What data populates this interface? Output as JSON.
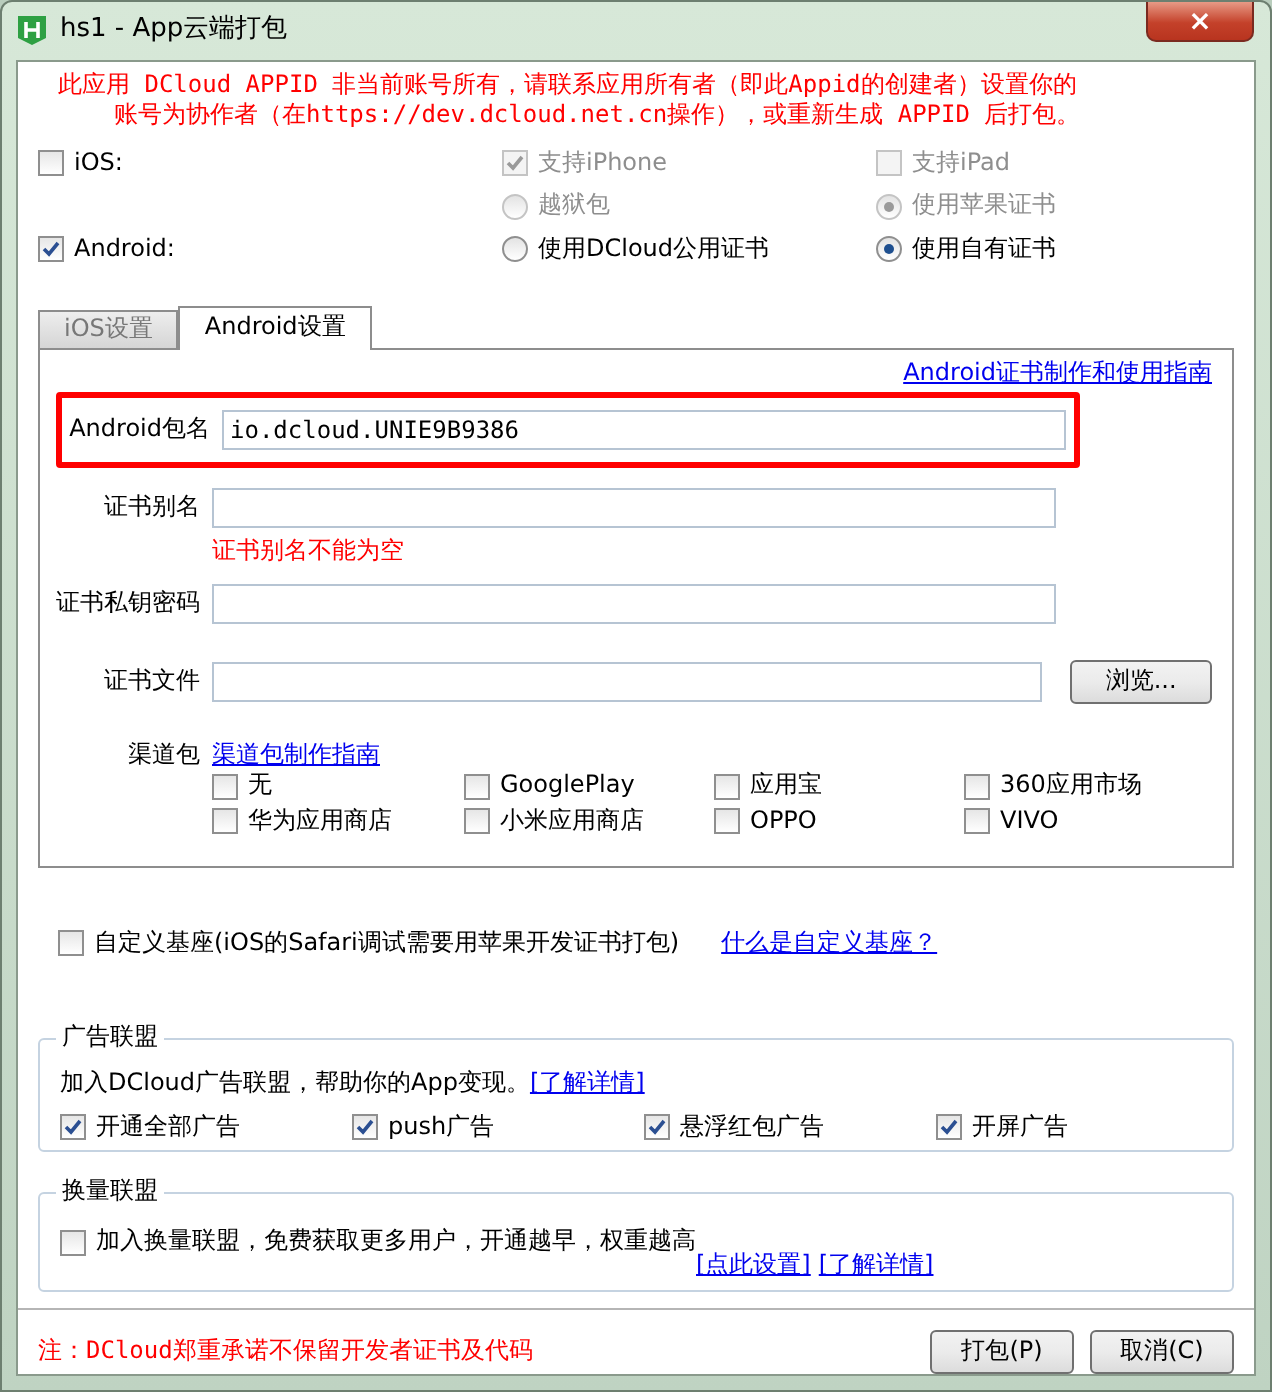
{
  "window": {
    "title": "hs1 - App云端打包",
    "close": "×"
  },
  "notice_lines": [
    "此应用 DCloud APPID 非当前账号所有，请联系应用所有者（即此Appid的创建者）设置你的",
    "账号为协作者（在https://dev.dcloud.net.cn操作），或重新生成 APPID 后打包。"
  ],
  "platform_rows": [
    [
      {
        "kind": "checkbox",
        "label": "iOS:",
        "checked": false,
        "disabled": false
      },
      {
        "kind": "checkbox",
        "label": "支持iPhone",
        "checked": true,
        "disabled": true
      },
      {
        "kind": "checkbox",
        "label": "支持iPad",
        "checked": false,
        "disabled": true
      }
    ],
    [
      {
        "kind": "empty"
      },
      {
        "kind": "radio",
        "label": "越狱包",
        "selected": false,
        "disabled": true
      },
      {
        "kind": "radio",
        "label": "使用苹果证书",
        "selected": true,
        "disabled": true
      }
    ],
    [
      {
        "kind": "checkbox",
        "label": "Android:",
        "checked": true,
        "disabled": false
      },
      {
        "kind": "radio",
        "label": "使用DCloud公用证书",
        "selected": false,
        "disabled": false
      },
      {
        "kind": "radio",
        "label": "使用自有证书",
        "selected": true,
        "disabled": false
      }
    ]
  ],
  "tabs": [
    {
      "label": "iOS设置",
      "selected": false
    },
    {
      "label": "Android设置",
      "selected": true
    }
  ],
  "android": {
    "guide_link": "Android证书制作和使用指南",
    "fields": [
      {
        "label": "Android包名",
        "value": "io.dcloud.UNIE9B9386",
        "highlighted": true
      },
      {
        "label": "证书别名",
        "highlighted": false,
        "error": "证书别名不能为空"
      },
      {
        "label": "证书私钥密码",
        "highlighted": false
      },
      {
        "label": "证书文件",
        "highlighted": false,
        "button": "浏览..."
      }
    ],
    "channels": {
      "label": "渠道包",
      "link": "渠道包制作指南",
      "options": [
        {
          "label": "无",
          "checked": false
        },
        {
          "label": "GooglePlay",
          "checked": false
        },
        {
          "label": "应用宝",
          "checked": false
        },
        {
          "label": "360应用市场",
          "checked": false
        },
        {
          "label": "华为应用商店",
          "checked": false
        },
        {
          "label": "小米应用商店",
          "checked": false
        },
        {
          "label": "OPPO",
          "checked": false
        },
        {
          "label": "VIVO",
          "checked": false
        }
      ]
    }
  },
  "custom_base": {
    "label": "自定义基座(iOS的Safari调试需要用苹果开发证书打包)",
    "checked": false,
    "link": "什么是自定义基座？"
  },
  "ad_union": {
    "legend": "广告联盟",
    "text": "加入DCloud广告联盟，帮助你的App变现。",
    "link": "[了解详情]",
    "options": [
      {
        "label": "开通全部广告",
        "checked": true
      },
      {
        "label": "push广告",
        "checked": true
      },
      {
        "label": "悬浮红包广告",
        "checked": true
      },
      {
        "label": "开屏广告",
        "checked": true
      }
    ]
  },
  "exchange_union": {
    "legend": "换量联盟",
    "label": "加入换量联盟，免费获取更多用户，开通越早，权重越高",
    "checked": false,
    "links": [
      "[点此设置]",
      "[了解详情]"
    ]
  },
  "footer": {
    "note": "注：DCloud郑重承诺不保留开发者证书及代码",
    "buttons": [
      "打包(P)",
      "取消(C)"
    ]
  }
}
